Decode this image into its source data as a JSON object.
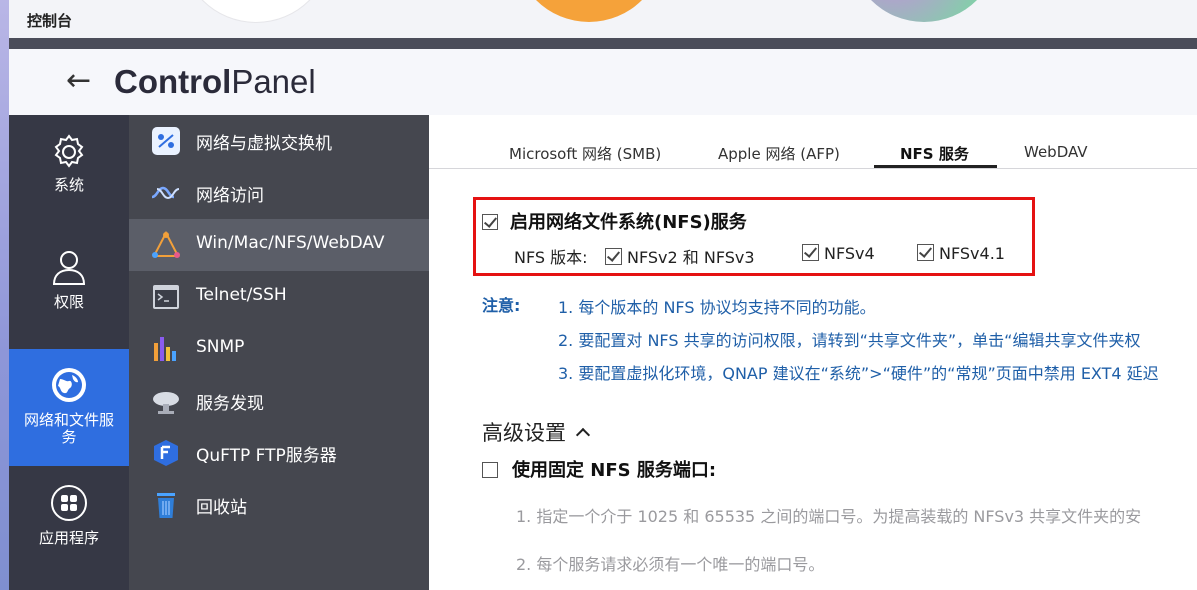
{
  "window": {
    "title": "控制台"
  },
  "header": {
    "brand_bold": "Control",
    "brand_light": "Panel",
    "back_icon": "arrow-left-icon"
  },
  "nav1": {
    "items": [
      {
        "label": "系统",
        "icon": "gear-icon",
        "active": false
      },
      {
        "label": "权限",
        "icon": "user-icon",
        "active": false
      },
      {
        "label": "网络和文件服\n务",
        "line1": "网络和文件服",
        "line2": "务",
        "icon": "globe-icon",
        "active": true
      },
      {
        "label": "应用程序",
        "icon": "apps-grid-icon",
        "active": false
      }
    ]
  },
  "nav2": {
    "items": [
      {
        "label": "网络与虚拟交换机",
        "icon": "network-switch-icon"
      },
      {
        "label": "网络访问",
        "icon": "network-access-icon"
      },
      {
        "label": "Win/Mac/NFS/WebDAV",
        "icon": "win-mac-nfs-icon",
        "active": true
      },
      {
        "label": "Telnet/SSH",
        "icon": "terminal-icon"
      },
      {
        "label": "SNMP",
        "icon": "bar-chart-icon"
      },
      {
        "label": "服务发现",
        "icon": "satellite-dish-icon"
      },
      {
        "label": "QuFTP FTP服务器",
        "icon": "ftp-icon"
      },
      {
        "label": "回收站",
        "icon": "trash-icon"
      }
    ]
  },
  "tabs": [
    {
      "label": "Microsoft 网络 (SMB)"
    },
    {
      "label": "Apple 网络 (AFP)"
    },
    {
      "label": "NFS 服务",
      "active": true
    },
    {
      "label": "WebDAV"
    }
  ],
  "nfs": {
    "enable_label": "启用网络文件系统(NFS)服务",
    "enable_checked": true,
    "version_label": "NFS 版本:",
    "versions": [
      {
        "label": "NFSv2 和 NFSv3",
        "checked": true
      },
      {
        "label": "NFSv4",
        "checked": true
      },
      {
        "label": "NFSv4.1",
        "checked": true
      }
    ]
  },
  "notes": {
    "label": "注意:",
    "items": [
      "1. 每个版本的 NFS 协议均支持不同的功能。",
      "2. 要配置对 NFS 共享的访问权限，请转到“共享文件夹”，单击“编辑共享文件夹权",
      "3. 要配置虚拟化环境，QNAP 建议在“系统”>“硬件”的“常规”页面中禁用 EXT4 延迟"
    ]
  },
  "advanced": {
    "title": "高级设置",
    "fixed_port_label": "使用固定 NFS 服务端口:",
    "fixed_port_checked": false,
    "hints": [
      "1. 指定一个介于 1025 和 65535 之间的端口号。为提高装载的 NFSv3 共享文件夹的安",
      "2. 每个服务请求必须有一个唯一的端口号。"
    ]
  },
  "colors": {
    "accent": "#2f6ee0",
    "highlight_box": "#e51212",
    "note_text": "#1f5fa8"
  }
}
